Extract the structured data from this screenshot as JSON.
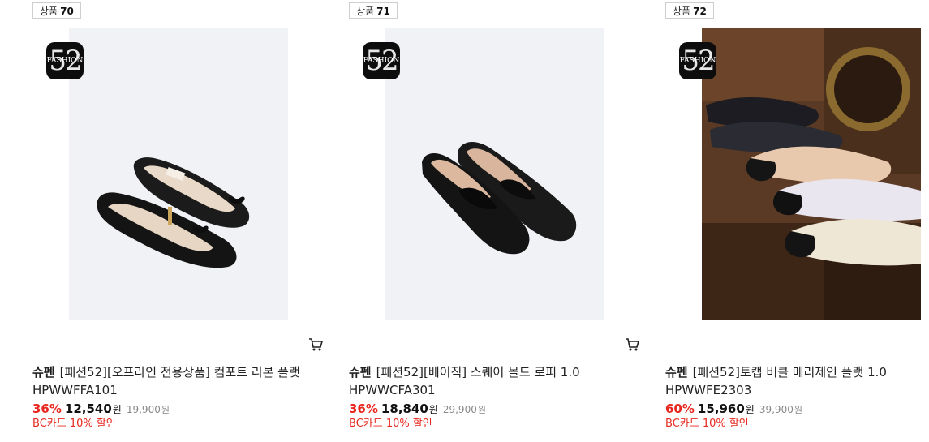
{
  "products": [
    {
      "badge_label": "상품",
      "badge_number": "70",
      "logo_text": "FASHION",
      "logo_number": "52",
      "brand": "슈펜",
      "name": "[패션52][오프라인 전용상품] 컴포트 리본 플랫",
      "sku": "HPWWFFA101",
      "discount": "36%",
      "price": "12,540",
      "price_unit": "원",
      "original_price": "19,900",
      "original_unit": "원",
      "card_discount": "BC카드 10% 할인",
      "image": "black-ribbon-flat-shoes"
    },
    {
      "badge_label": "상품",
      "badge_number": "71",
      "logo_text": "FASHION",
      "logo_number": "52",
      "brand": "슈펜",
      "name": "[패션52][베이직] 스퀘어 몰드 로퍼 1.0",
      "sku": "HPWWCFA301",
      "discount": "36%",
      "price": "18,840",
      "price_unit": "원",
      "original_price": "29,900",
      "original_unit": "원",
      "card_discount": "BC카드 10% 할인",
      "image": "black-square-loafers"
    },
    {
      "badge_label": "상품",
      "badge_number": "72",
      "logo_text": "FASHION",
      "logo_number": "52",
      "brand": "슈펜",
      "name": "[패션52]토캡 버클 메리제인 플랫 1.0",
      "sku": "HPWWFE2303",
      "discount": "60%",
      "price": "15,960",
      "price_unit": "원",
      "original_price": "39,900",
      "original_unit": "원",
      "card_discount": "BC카드 10% 할인",
      "image": "toe-cap-mary-jane-flats"
    }
  ],
  "icons": {
    "cart": "cart-icon"
  },
  "colors": {
    "discount": "#e8281f",
    "image_bg": "#f0f2f5",
    "logo_bg": "#0d0d0d"
  }
}
